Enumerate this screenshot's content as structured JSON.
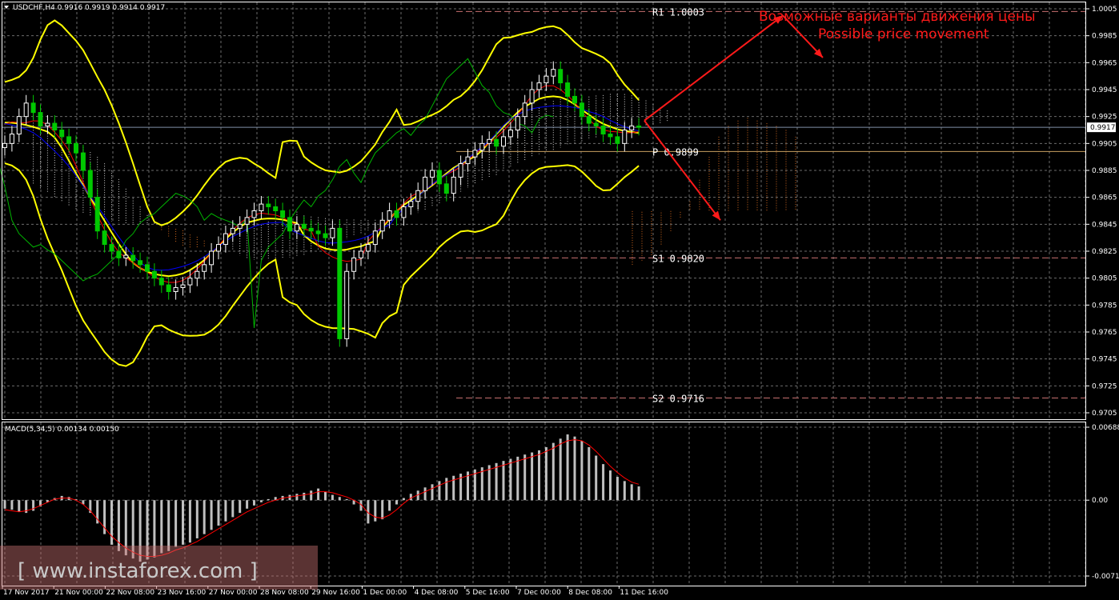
{
  "window": {
    "symbol_header": "USDCHF,H4  0.9916 0.9919 0.9914 0.9917",
    "macd_header": "MACD(5,34,5) 0.00134 0.00150",
    "current_price_label": "0.9917"
  },
  "annotation": {
    "line_ru": "Возможные варианты движения цены",
    "line_en": "Possible price movement"
  },
  "watermark": "[ www.instaforex.com ]",
  "colors": {
    "background": "#000000",
    "grid": "#6b6b6b",
    "bullish": "#ffffff",
    "bearish": "#00c800",
    "bollinger": "#ffff00",
    "ma_fast": "#ff0000",
    "ma_slow": "#0000ff",
    "lagging": "#00b400",
    "cloud_bull": "#d8d8d8",
    "cloud_bear": "#d2691e",
    "pivot": "#ffffff",
    "arrow": "#ff1a1a",
    "macd_hist": "#c0c0c0",
    "macd_signal": "#ff0000"
  },
  "chart_data": [
    {
      "type": "candlestick",
      "ylim": [
        0.9705,
        1.0005
      ],
      "yticks": [
        "1.0005",
        "0.9985",
        "0.9965",
        "0.9945",
        "0.9925",
        "0.9905",
        "0.9885",
        "0.9865",
        "0.9845",
        "0.9825",
        "0.9805",
        "0.9785",
        "0.9765",
        "0.9745",
        "0.9725",
        "0.9705"
      ],
      "xticks": [
        "17 Nov 2017",
        "21 Nov 00:00",
        "22 Nov 08:00",
        "23 Nov 16:00",
        "27 Nov 00:00",
        "28 Nov 08:00",
        "29 Nov 16:00",
        "1 Dec 00:00",
        "4 Dec 08:00",
        "5 Dec 16:00",
        "7 Dec 00:00",
        "8 Dec 08:00",
        "11 Dec 16:00"
      ],
      "last_price": 0.9917,
      "levels": [
        {
          "label": "R1",
          "value": "1.0003",
          "price": 1.0003
        },
        {
          "label": "P",
          "value": "0.9899",
          "price": 0.9899
        },
        {
          "label": "S1",
          "value": "0.9820",
          "price": 0.982
        },
        {
          "label": "S2",
          "value": "0.9716",
          "price": 0.9716
        }
      ],
      "price_path": [
        0.9905,
        0.9912,
        0.9925,
        0.9935,
        0.9928,
        0.9918,
        0.992,
        0.9915,
        0.991,
        0.9905,
        0.9898,
        0.9885,
        0.9865,
        0.984,
        0.983,
        0.9825,
        0.982,
        0.9822,
        0.9818,
        0.9815,
        0.981,
        0.9805,
        0.98,
        0.9795,
        0.9798,
        0.98,
        0.9805,
        0.981,
        0.9815,
        0.9825,
        0.983,
        0.9838,
        0.9842,
        0.9845,
        0.985,
        0.9855,
        0.986,
        0.9858,
        0.9855,
        0.985,
        0.984,
        0.9845,
        0.9842,
        0.984,
        0.9838,
        0.9835,
        0.9842,
        0.976,
        0.981,
        0.982,
        0.9825,
        0.983,
        0.984,
        0.9848,
        0.9855,
        0.985,
        0.9858,
        0.9862,
        0.987,
        0.988,
        0.9885,
        0.9875,
        0.9868,
        0.988,
        0.989,
        0.9895,
        0.99,
        0.9905,
        0.9908,
        0.9903,
        0.991,
        0.9915,
        0.9925,
        0.9935,
        0.9945,
        0.995,
        0.9955,
        0.996,
        0.995,
        0.994,
        0.9935,
        0.9925,
        0.992,
        0.9918,
        0.9912,
        0.991,
        0.9905,
        0.9915,
        0.9918,
        0.9917
      ],
      "forecast": {
        "from": 0.9922,
        "up_target": 1.0,
        "down_target": 0.9848
      }
    },
    {
      "type": "bar",
      "title": "MACD(5,34,5) 0.00134 0.00150",
      "ylim": [
        -0.00715,
        0.00688
      ],
      "yticks": [
        "0.00688",
        "0.00",
        "-0.00715"
      ],
      "histogram": [
        -0.0008,
        -0.0009,
        -0.0011,
        -0.0012,
        -0.001,
        -0.0006,
        -0.0002,
        0.0002,
        0.0004,
        0.0003,
        0.0001,
        -0.0004,
        -0.0012,
        -0.0022,
        -0.0032,
        -0.0042,
        -0.0048,
        -0.0052,
        -0.0055,
        -0.0058,
        -0.0056,
        -0.0054,
        -0.005,
        -0.0048,
        -0.0044,
        -0.0042,
        -0.004,
        -0.0036,
        -0.0032,
        -0.0028,
        -0.0024,
        -0.002,
        -0.0016,
        -0.0012,
        -0.0008,
        -0.0005,
        -0.0002,
        0.0001,
        0.0003,
        0.0004,
        0.0005,
        0.0006,
        0.0007,
        0.0009,
        0.0011,
        0.0008,
        0.0005,
        0.0003,
        0.0001,
        -0.0004,
        -0.001,
        -0.0022,
        -0.002,
        -0.0018,
        -0.001,
        -0.0004,
        0.0002,
        0.0006,
        0.0009,
        0.0012,
        0.0015,
        0.0018,
        0.0021,
        0.0023,
        0.0025,
        0.0027,
        0.0029,
        0.0031,
        0.0033,
        0.0035,
        0.0037,
        0.0039,
        0.0041,
        0.0043,
        0.0045,
        0.0047,
        0.005,
        0.0054,
        0.0058,
        0.0062,
        0.006,
        0.0056,
        0.005,
        0.0042,
        0.0034,
        0.0028,
        0.0022,
        0.0018,
        0.0015,
        0.0013
      ],
      "signal": [
        -0.0009,
        -0.001,
        -0.0011,
        -0.001,
        -0.0008,
        -0.0005,
        -0.0002,
        0.0001,
        0.0002,
        0.0002,
        0.0,
        -0.0004,
        -0.001,
        -0.0018,
        -0.0026,
        -0.0034,
        -0.004,
        -0.0045,
        -0.0049,
        -0.0052,
        -0.0053,
        -0.0053,
        -0.0052,
        -0.005,
        -0.0047,
        -0.0045,
        -0.0042,
        -0.0039,
        -0.0035,
        -0.0031,
        -0.0027,
        -0.0023,
        -0.0019,
        -0.0015,
        -0.0011,
        -0.0008,
        -0.0005,
        -0.0002,
        0.0,
        0.0002,
        0.0003,
        0.0004,
        0.0005,
        0.0006,
        0.0008,
        0.0008,
        0.0007,
        0.0005,
        0.0003,
        0.0,
        -0.0004,
        -0.0012,
        -0.0016,
        -0.0017,
        -0.0014,
        -0.0009,
        -0.0003,
        0.0002,
        0.0005,
        0.0008,
        0.0011,
        0.0014,
        0.0017,
        0.0019,
        0.0021,
        0.0023,
        0.0025,
        0.0027,
        0.0029,
        0.0031,
        0.0033,
        0.0035,
        0.0037,
        0.0039,
        0.0041,
        0.0043,
        0.0046,
        0.0049,
        0.0053,
        0.0056,
        0.0057,
        0.0056,
        0.0052,
        0.0046,
        0.0039,
        0.0032,
        0.0026,
        0.0021,
        0.0017,
        0.0015
      ]
    }
  ]
}
